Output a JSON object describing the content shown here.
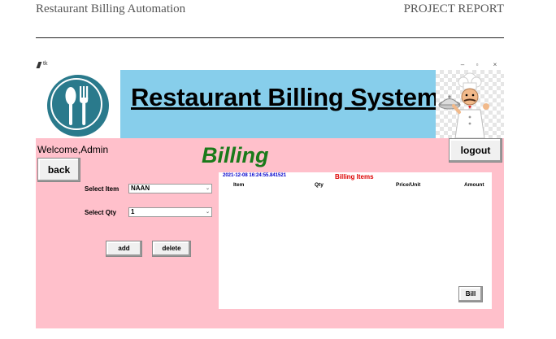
{
  "document": {
    "header_left": "Restaurant Billing Automation",
    "header_right": "PROJECT REPORT"
  },
  "window": {
    "title": "tk",
    "controls": {
      "minimize": "–",
      "maximize": "▫",
      "close": "×"
    }
  },
  "banner": {
    "title": "Restaurant Billing System"
  },
  "welcome_text": "Welcome,Admin",
  "page_heading": "Billing",
  "buttons": {
    "logout": "logout",
    "back": "back",
    "add": "add",
    "delete": "delete",
    "bill": "Bill"
  },
  "form": {
    "item_label": "Select Item",
    "item_value": "NAAN",
    "qty_label": "Select Qty",
    "qty_value": "1"
  },
  "bill_panel": {
    "timestamp": "2021-12-08 16:24:55.841521",
    "title": "Billing Items",
    "columns": [
      "Item",
      "Qty",
      "Price/Unit",
      "Amount"
    ]
  },
  "colors": {
    "window_bg": "#ffc0cb",
    "banner_bg": "#87ceeb",
    "heading": "#1a7a1a",
    "logo": "#2a7a8c",
    "timestamp": "#0000cc",
    "items_title": "#dd0000"
  },
  "icons": [
    "feather-icon",
    "spoon-fork-logo-icon",
    "chef-image-icon",
    "dropdown-arrow-icon"
  ]
}
